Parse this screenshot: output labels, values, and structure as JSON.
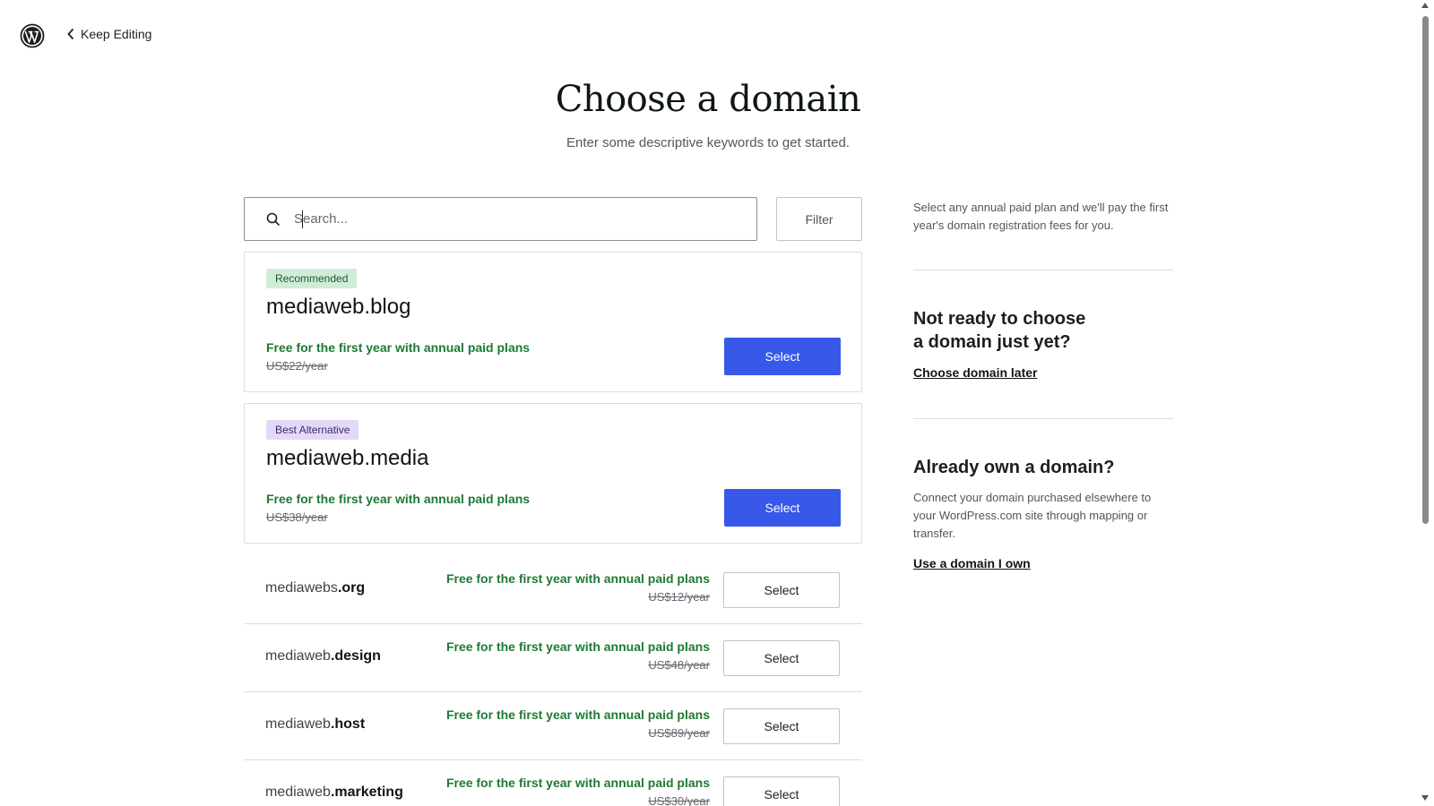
{
  "header": {
    "logo": "wordpress-logo",
    "back_label": "Keep Editing"
  },
  "page": {
    "title": "Choose a domain",
    "subtitle": "Enter some descriptive keywords to get started."
  },
  "search": {
    "placeholder": "Search...",
    "value": "",
    "filter_label": "Filter"
  },
  "featured": [
    {
      "badge": "Recommended",
      "domain": "mediaweb.blog",
      "promo": "Free for the first year with annual paid plans",
      "price": "US$22/year",
      "button": "Select"
    },
    {
      "badge": "Best Alternative",
      "domain": "mediaweb.media",
      "promo": "Free for the first year with annual paid plans",
      "price": "US$38/year",
      "button": "Select"
    }
  ],
  "results": [
    {
      "name": "mediawebs",
      "tld": ".org",
      "promo": "Free for the first year with annual paid plans",
      "price": "US$12/year",
      "button": "Select"
    },
    {
      "name": "mediaweb",
      "tld": ".design",
      "promo": "Free for the first year with annual paid plans",
      "price": "US$48/year",
      "button": "Select"
    },
    {
      "name": "mediaweb",
      "tld": ".host",
      "promo": "Free for the first year with annual paid plans",
      "price": "US$89/year",
      "button": "Select"
    },
    {
      "name": "mediaweb",
      "tld": ".marketing",
      "promo": "Free for the first year with annual paid plans",
      "price": "US$30/year",
      "button": "Select"
    }
  ],
  "sidebar": {
    "note": "Select any annual paid plan and we'll pay the first year's domain registration fees for you.",
    "not_ready_heading": "Not ready to choose a domain just yet?",
    "choose_later_link": "Choose domain later",
    "own_heading": "Already own a domain?",
    "own_text": "Connect your domain purchased elsewhere to your WordPress.com site through mapping or transfer.",
    "own_link": "Use a domain I own"
  },
  "colors": {
    "primary": "#3858e9",
    "promo_green": "#1e7a33",
    "recommended_badge": "#d0ecd8",
    "alternative_badge": "#e3d9f7"
  }
}
